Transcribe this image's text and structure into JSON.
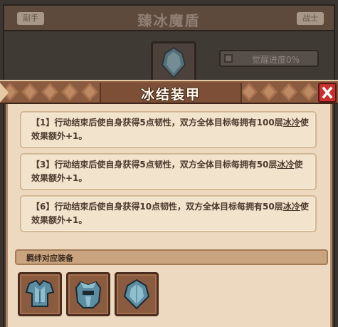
{
  "background": {
    "title": "臻冰魔盾",
    "left_tag": "副手",
    "right_tag": "战士",
    "awaken_progress": "觉醒进度0%"
  },
  "modal": {
    "title": "冰结装甲",
    "close_icon": "close-icon",
    "effects": [
      {
        "prefix": "【1】行动结束后使自身获得5点韧性，双方全体目标每拥有100层",
        "link": "冰冷",
        "suffix": "使效果额外+1。"
      },
      {
        "prefix": "【3】行动结束后使自身获得5点韧性，双方全体目标每拥有50层",
        "link": "冰冷",
        "suffix": "使效果额外+1。"
      },
      {
        "prefix": "【6】行动结束后使自身获得10点韧性，双方全体目标每拥有50层",
        "link": "冰冷",
        "suffix": "使效果额外+1。"
      }
    ],
    "section_label": "羁绊对应装备",
    "equipment": [
      {
        "icon": "ice-chest-armor-icon"
      },
      {
        "icon": "ice-helmet-icon"
      },
      {
        "icon": "ice-shield-icon"
      }
    ]
  },
  "colors": {
    "header_brown": "#8a5b3f",
    "panel_beige": "#ecd9bf",
    "close_red": "#c7302d",
    "ice_blue": "#6f9fb3"
  }
}
